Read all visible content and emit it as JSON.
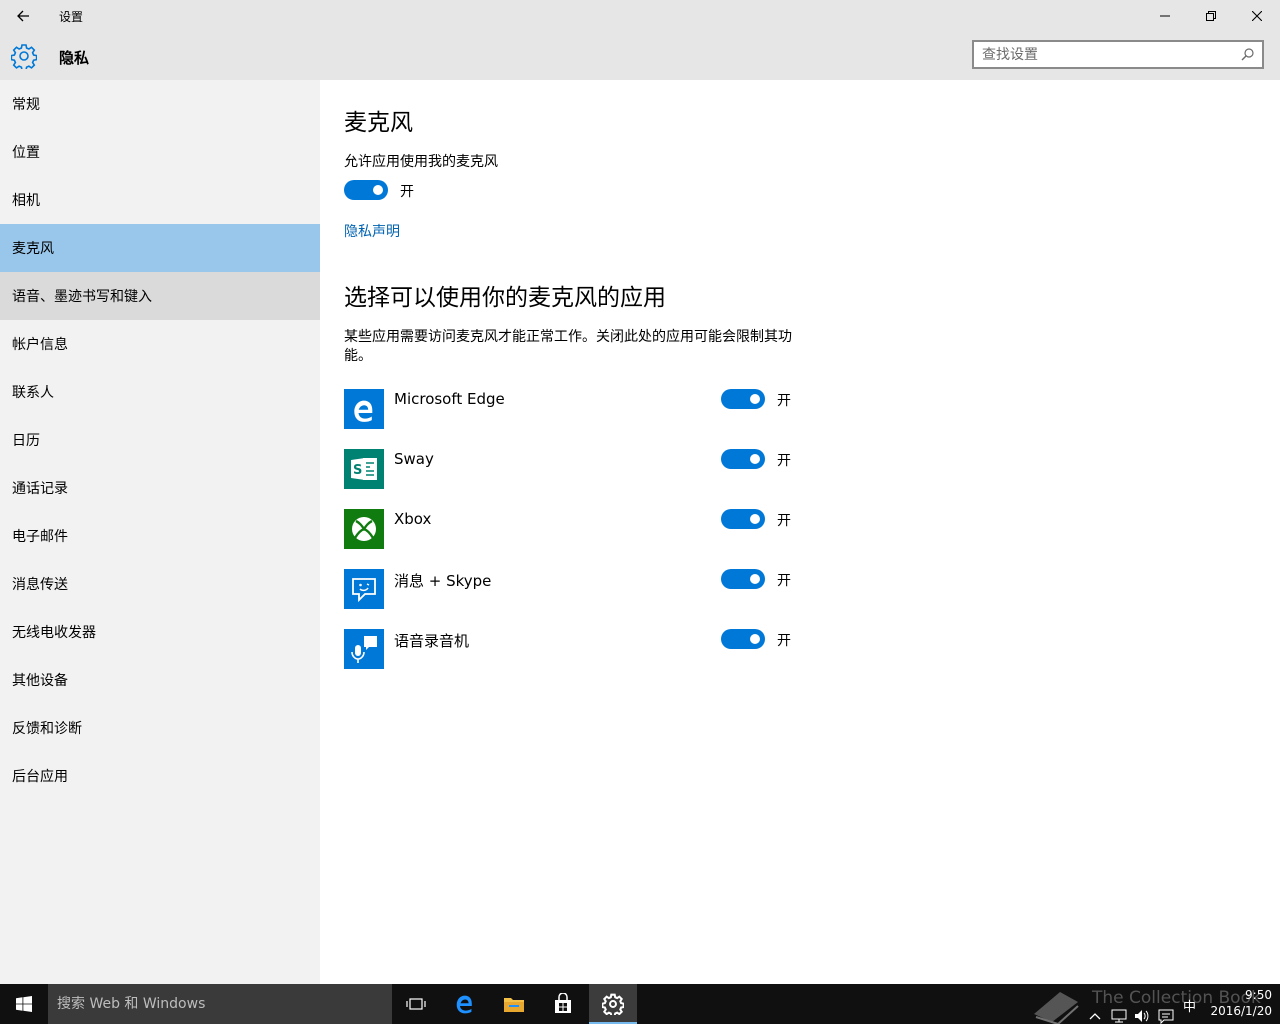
{
  "window": {
    "title": "设置",
    "page_title": "隐私"
  },
  "search": {
    "placeholder": "查找设置"
  },
  "sidebar": {
    "items": [
      {
        "label": "常规"
      },
      {
        "label": "位置"
      },
      {
        "label": "相机"
      },
      {
        "label": "麦克风",
        "state": "selected"
      },
      {
        "label": "语音、墨迹书写和键入",
        "state": "hover"
      },
      {
        "label": "帐户信息"
      },
      {
        "label": "联系人"
      },
      {
        "label": "日历"
      },
      {
        "label": "通话记录"
      },
      {
        "label": "电子邮件"
      },
      {
        "label": "消息传送"
      },
      {
        "label": "无线电收发器"
      },
      {
        "label": "其他设备"
      },
      {
        "label": "反馈和诊断"
      },
      {
        "label": "后台应用"
      }
    ]
  },
  "main": {
    "heading": "麦克风",
    "master_label": "允许应用使用我的麦克风",
    "master_toggle": {
      "on": true,
      "state_text": "开"
    },
    "privacy_link": "隐私声明",
    "apps_heading": "选择可以使用你的麦克风的应用",
    "apps_description": "某些应用需要访问麦克风才能正常工作。关闭此处的应用可能会限制其功能。",
    "apps": [
      {
        "name": "Microsoft Edge",
        "icon": "edge-icon",
        "on": true,
        "state_text": "开",
        "color": "#0078d7"
      },
      {
        "name": "Sway",
        "icon": "sway-icon",
        "on": true,
        "state_text": "开",
        "color": "#008272"
      },
      {
        "name": "Xbox",
        "icon": "xbox-icon",
        "on": true,
        "state_text": "开",
        "color": "#107c10"
      },
      {
        "name": "消息 + Skype",
        "icon": "messaging-icon",
        "on": true,
        "state_text": "开",
        "color": "#0078d7"
      },
      {
        "name": "语音录音机",
        "icon": "voice-recorder-icon",
        "on": true,
        "state_text": "开",
        "color": "#0078d7"
      }
    ]
  },
  "taskbar": {
    "search_placeholder": "搜索 Web 和 Windows",
    "pinned": [
      "task-view-icon",
      "edge-icon",
      "file-explorer-icon",
      "store-icon",
      "settings-icon"
    ],
    "ime": "中",
    "time": "9:50",
    "date": "2016/1/20",
    "watermark": "The Collection Book"
  },
  "colors": {
    "accent": "#0078d7",
    "selected_nav": "#99c7eb",
    "link": "#0063b1",
    "titlebar": "#e6e6e6",
    "sidebar": "#f2f2f2",
    "taskbar": "#101010"
  }
}
